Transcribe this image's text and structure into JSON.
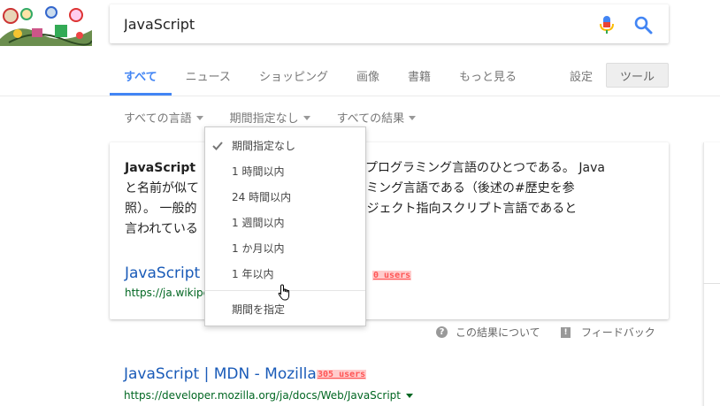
{
  "search": {
    "query": "JavaScript"
  },
  "tabs": [
    {
      "label": "すべて",
      "active": true
    },
    {
      "label": "ニュース"
    },
    {
      "label": "ショッピング"
    },
    {
      "label": "画像"
    },
    {
      "label": "書籍"
    },
    {
      "label": "もっと見る"
    }
  ],
  "settings_label": "設定",
  "tools_label": "ツール",
  "filters": [
    {
      "label": "すべての言語"
    },
    {
      "label": "期間指定なし"
    },
    {
      "label": "すべての結果"
    }
  ],
  "card": {
    "title_bold": "JavaScript",
    "line1_right": "、プログラミング言語のひとつである。 Java",
    "line2_left": "と名前が似て",
    "line2_right": "グラミング言語である（後述の#歴史を参",
    "line3_left": "照）。 一般的",
    "line3_right": "のオブジェクト指向スクリプト言語であると",
    "line4_left": "言われている",
    "link_text": "JavaScript -",
    "url_text": "https://ja.wikipe",
    "users_badge": "0 users"
  },
  "dropdown": {
    "items": [
      {
        "label": "期間指定なし",
        "checked": true
      },
      {
        "label": "1 時間以内"
      },
      {
        "label": "24 時間以内"
      },
      {
        "label": "1 週間以内"
      },
      {
        "label": "1 か月以内"
      },
      {
        "label": "1 年以内"
      }
    ],
    "custom_label": "期間を指定"
  },
  "about_label": "この結果について",
  "feedback_label": "フィードバック",
  "result2": {
    "title": "JavaScript | MDN - Mozilla",
    "users_badge": "305 users",
    "url": "https://developer.mozilla.org/ja/docs/Web/JavaScript"
  },
  "colors": {
    "accent": "#4285f4",
    "link": "#1a5bb8",
    "url_green": "#006621",
    "badge_red": "#ff5555"
  }
}
